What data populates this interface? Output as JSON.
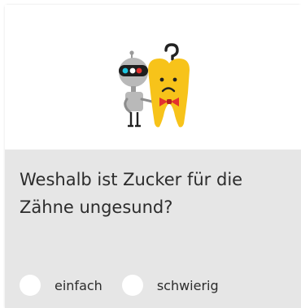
{
  "card": {
    "question": "Weshalb ist Zucker für die Zähne ungesund?",
    "illustration": {
      "icon": "robot-and-tooth-icon",
      "colors": {
        "tooth": "#f7c31a",
        "robot": "#b9b9b9",
        "bowtie": "#e3312f",
        "eyes": "#1ec6e0"
      }
    },
    "options": [
      {
        "label": "einfach"
      },
      {
        "label": "schwierig"
      }
    ],
    "colors": {
      "panel_background": "#e6e6e6",
      "text": "#2c2c2c",
      "radio": "#ffffff"
    }
  }
}
